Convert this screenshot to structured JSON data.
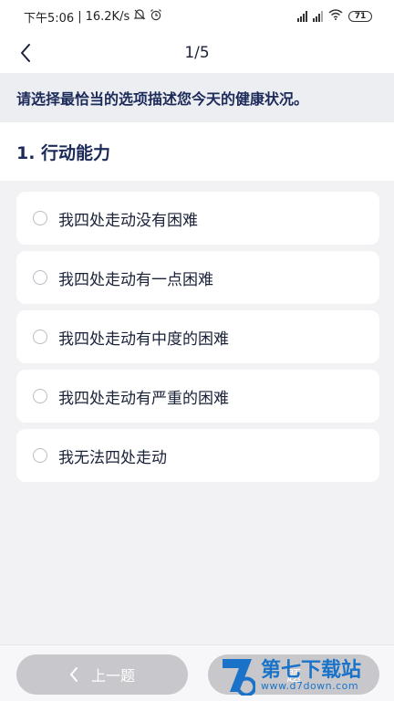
{
  "status_bar": {
    "time": "下午5:06",
    "speed": "16.2K/s",
    "battery": "71"
  },
  "nav": {
    "progress": "1/5"
  },
  "instruction": "请选择最恰当的选项描述您今天的健康状况。",
  "question": {
    "title": "1. 行动能力"
  },
  "options": [
    {
      "label": "我四处走动没有困难"
    },
    {
      "label": "我四处走动有一点困难"
    },
    {
      "label": "我四处走动有中度的困难"
    },
    {
      "label": "我四处走动有严重的困难"
    },
    {
      "label": "我无法四处走动"
    }
  ],
  "bottom": {
    "prev_label": "上一题",
    "next_label": "题"
  },
  "watermark": {
    "title": "第七下载站",
    "url": "www.d7down.com"
  },
  "colors": {
    "primary_text": "#1c2a5a",
    "button_disabled": "#c8c8cc",
    "watermark": "#1a73c8"
  }
}
